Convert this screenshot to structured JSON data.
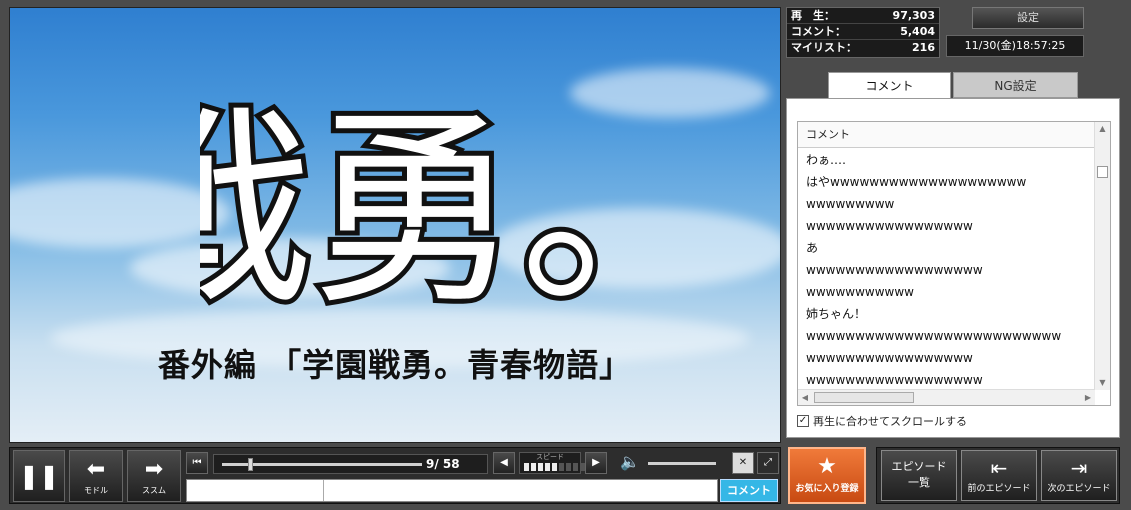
{
  "video": {
    "logo_text": "戦勇。",
    "subtitle": "番外編 「学園戦勇。青春物語」"
  },
  "stats": {
    "views_label": "再　生：",
    "views": "97,303",
    "comments_label": "コメント：",
    "comments": "5,404",
    "mylist_label": "マイリスト：",
    "mylist": "216"
  },
  "settings_label": "設定",
  "datetime": "11/30(金)18:57:25",
  "tabs": {
    "comment": "コメント",
    "ng": "NG設定"
  },
  "comment_list": {
    "header": "コメント",
    "items": [
      "わぁ‥‥",
      "はやwwwwwwwwwwwwwwwwwwww",
      "wwwwwwwww",
      "wwwwwwwwwwwwwwwww",
      "あ",
      "wwwwwwwwwwwwwwwwww",
      "wwwwwwwwwww",
      "姉ちゃん！",
      "wwwwwwwwwwwwwwwwwwwwwwwwww",
      "wwwwwwwwwwwwwwwww",
      "wwwwwwwwwwwwwwwwww"
    ]
  },
  "autoscroll_label": "再生に合わせてスクロールする",
  "player": {
    "back_label": "モドル",
    "forward_label": "ススム",
    "time": "9/ 58",
    "speed_label": "スピード",
    "speed_level": 5,
    "speed_max": 10,
    "comment_submit": "コメント"
  },
  "favorite_label": "お気に入り登録",
  "episodes": {
    "list_line1": "エピソード",
    "list_line2": "一覧",
    "prev": "前のエピソード",
    "next": "次のエピソード"
  }
}
